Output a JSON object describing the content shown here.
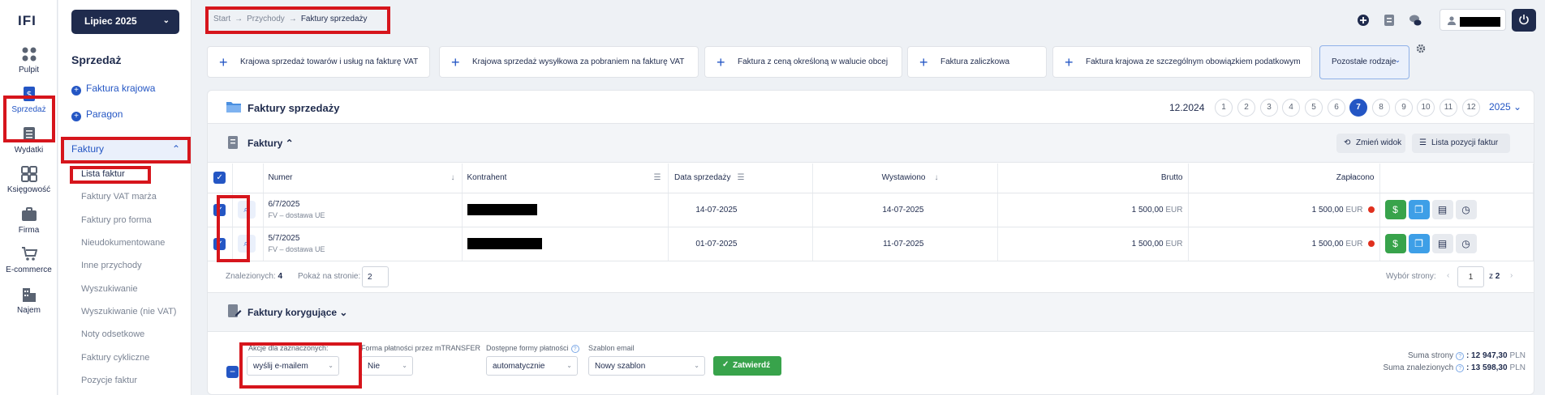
{
  "logo": {
    "text": "IFI"
  },
  "rail": [
    {
      "label": "Pulpit",
      "icon": "dashboard-icon"
    },
    {
      "label": "Sprzedaż",
      "icon": "sales-icon"
    },
    {
      "label": "Wydatki",
      "icon": "expenses-icon"
    },
    {
      "label": "Księgowość",
      "icon": "accounting-icon"
    },
    {
      "label": "Firma",
      "icon": "briefcase-icon"
    },
    {
      "label": "E-commerce",
      "icon": "cart-icon"
    },
    {
      "label": "Najem",
      "icon": "building-icon"
    }
  ],
  "sidebar": {
    "month": "Lipiec 2025",
    "title": "Sprzedaż",
    "links": [
      "Faktura krajowa",
      "Paragon"
    ],
    "group": "Faktury",
    "subitems": [
      "Lista faktur",
      "Faktury VAT marża",
      "Faktury pro forma",
      "Nieudokumentowane",
      "Inne przychody",
      "Wyszukiwanie",
      "Wyszukiwanie (nie VAT)",
      "Noty odsetkowe",
      "Faktury cykliczne",
      "Pozycje faktur"
    ]
  },
  "breadcrumb": {
    "items": [
      "Start",
      "Przychody"
    ],
    "current": "Faktury sprzedaży",
    "sep": "→"
  },
  "quick_actions": [
    "Krajowa sprzedaż towarów i usług na fakturę VAT",
    "Krajowa sprzedaż wysyłkowa za pobraniem na fakturę VAT",
    "Faktura z ceną określoną w walucie obcej",
    "Faktura zaliczkowa",
    "Faktura krajowa ze szczególnym obowiązkiem podatkowym"
  ],
  "more_types": "Pozostałe rodzaje",
  "panel": {
    "title": "Faktury sprzedaży",
    "period": "12.2024",
    "months": [
      "1",
      "2",
      "3",
      "4",
      "5",
      "6",
      "7",
      "8",
      "9",
      "10",
      "11",
      "12"
    ],
    "active_month": "7",
    "year": "2025 ⌄"
  },
  "section": {
    "title": "Faktury ⌃",
    "change_view": "Zmień widok",
    "positions_list": "Lista pozycji faktur"
  },
  "table": {
    "headers": [
      "Numer",
      "Kontrahent",
      "Data sprzedaży",
      "Wystawiono",
      "Brutto",
      "Zapłacono"
    ],
    "rows": [
      {
        "number": "6/7/2025",
        "type": "FV – dostawa UE",
        "sale_date": "14-07-2025",
        "issued": "14-07-2025",
        "gross": "1 500,00",
        "gross_cur": "EUR",
        "paid": "1 500,00",
        "paid_cur": "EUR"
      },
      {
        "number": "5/7/2025",
        "type": "FV – dostawa UE",
        "sale_date": "01-07-2025",
        "issued": "11-07-2025",
        "gross": "1 500,00",
        "gross_cur": "EUR",
        "paid": "1 500,00",
        "paid_cur": "EUR"
      }
    ]
  },
  "footer": {
    "found_label": "Znalezionych:",
    "found_count": "4",
    "per_page_label": "Pokaż na stronie:",
    "per_page_value": "2",
    "page_label": "Wybór strony:",
    "page_value": "1",
    "page_of": "z",
    "page_total": "2"
  },
  "corrections": {
    "title": "Faktury korygujące ⌄"
  },
  "bulk": {
    "actions_label": "Akcje dla zaznaczonych:",
    "actions_value": "wyślij e-mailem",
    "mtransfer_label": "Forma płatności przez mTRANSFER",
    "mtransfer_value": "Nie",
    "payment_label": "Dostępne formy płatności",
    "payment_value": "automatycznie",
    "template_label": "Szablon email",
    "template_value": "Nowy szablon",
    "confirm": "Zatwierdź"
  },
  "sums": {
    "page_label": "Suma strony",
    "page_value": ": 12 947,30",
    "found_label": "Suma znalezionych",
    "found_value": ": 13 598,30",
    "currency": "PLN"
  },
  "colors": {
    "primary": "#2456c4",
    "navy": "#1f2b4d",
    "green": "#38a34b",
    "highlight": "#d6151c"
  }
}
